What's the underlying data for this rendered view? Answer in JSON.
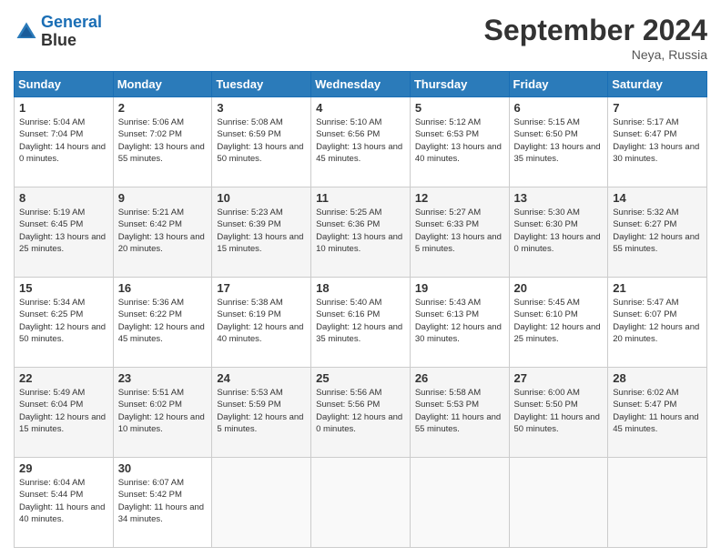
{
  "header": {
    "logo_line1": "General",
    "logo_line2": "Blue",
    "month": "September 2024",
    "location": "Neya, Russia"
  },
  "weekdays": [
    "Sunday",
    "Monday",
    "Tuesday",
    "Wednesday",
    "Thursday",
    "Friday",
    "Saturday"
  ],
  "weeks": [
    [
      {
        "day": "1",
        "sunrise": "5:04 AM",
        "sunset": "7:04 PM",
        "daylight": "14 hours and 0 minutes."
      },
      {
        "day": "2",
        "sunrise": "5:06 AM",
        "sunset": "7:02 PM",
        "daylight": "13 hours and 55 minutes."
      },
      {
        "day": "3",
        "sunrise": "5:08 AM",
        "sunset": "6:59 PM",
        "daylight": "13 hours and 50 minutes."
      },
      {
        "day": "4",
        "sunrise": "5:10 AM",
        "sunset": "6:56 PM",
        "daylight": "13 hours and 45 minutes."
      },
      {
        "day": "5",
        "sunrise": "5:12 AM",
        "sunset": "6:53 PM",
        "daylight": "13 hours and 40 minutes."
      },
      {
        "day": "6",
        "sunrise": "5:15 AM",
        "sunset": "6:50 PM",
        "daylight": "13 hours and 35 minutes."
      },
      {
        "day": "7",
        "sunrise": "5:17 AM",
        "sunset": "6:47 PM",
        "daylight": "13 hours and 30 minutes."
      }
    ],
    [
      {
        "day": "8",
        "sunrise": "5:19 AM",
        "sunset": "6:45 PM",
        "daylight": "13 hours and 25 minutes."
      },
      {
        "day": "9",
        "sunrise": "5:21 AM",
        "sunset": "6:42 PM",
        "daylight": "13 hours and 20 minutes."
      },
      {
        "day": "10",
        "sunrise": "5:23 AM",
        "sunset": "6:39 PM",
        "daylight": "13 hours and 15 minutes."
      },
      {
        "day": "11",
        "sunrise": "5:25 AM",
        "sunset": "6:36 PM",
        "daylight": "13 hours and 10 minutes."
      },
      {
        "day": "12",
        "sunrise": "5:27 AM",
        "sunset": "6:33 PM",
        "daylight": "13 hours and 5 minutes."
      },
      {
        "day": "13",
        "sunrise": "5:30 AM",
        "sunset": "6:30 PM",
        "daylight": "13 hours and 0 minutes."
      },
      {
        "day": "14",
        "sunrise": "5:32 AM",
        "sunset": "6:27 PM",
        "daylight": "12 hours and 55 minutes."
      }
    ],
    [
      {
        "day": "15",
        "sunrise": "5:34 AM",
        "sunset": "6:25 PM",
        "daylight": "12 hours and 50 minutes."
      },
      {
        "day": "16",
        "sunrise": "5:36 AM",
        "sunset": "6:22 PM",
        "daylight": "12 hours and 45 minutes."
      },
      {
        "day": "17",
        "sunrise": "5:38 AM",
        "sunset": "6:19 PM",
        "daylight": "12 hours and 40 minutes."
      },
      {
        "day": "18",
        "sunrise": "5:40 AM",
        "sunset": "6:16 PM",
        "daylight": "12 hours and 35 minutes."
      },
      {
        "day": "19",
        "sunrise": "5:43 AM",
        "sunset": "6:13 PM",
        "daylight": "12 hours and 30 minutes."
      },
      {
        "day": "20",
        "sunrise": "5:45 AM",
        "sunset": "6:10 PM",
        "daylight": "12 hours and 25 minutes."
      },
      {
        "day": "21",
        "sunrise": "5:47 AM",
        "sunset": "6:07 PM",
        "daylight": "12 hours and 20 minutes."
      }
    ],
    [
      {
        "day": "22",
        "sunrise": "5:49 AM",
        "sunset": "6:04 PM",
        "daylight": "12 hours and 15 minutes."
      },
      {
        "day": "23",
        "sunrise": "5:51 AM",
        "sunset": "6:02 PM",
        "daylight": "12 hours and 10 minutes."
      },
      {
        "day": "24",
        "sunrise": "5:53 AM",
        "sunset": "5:59 PM",
        "daylight": "12 hours and 5 minutes."
      },
      {
        "day": "25",
        "sunrise": "5:56 AM",
        "sunset": "5:56 PM",
        "daylight": "12 hours and 0 minutes."
      },
      {
        "day": "26",
        "sunrise": "5:58 AM",
        "sunset": "5:53 PM",
        "daylight": "11 hours and 55 minutes."
      },
      {
        "day": "27",
        "sunrise": "6:00 AM",
        "sunset": "5:50 PM",
        "daylight": "11 hours and 50 minutes."
      },
      {
        "day": "28",
        "sunrise": "6:02 AM",
        "sunset": "5:47 PM",
        "daylight": "11 hours and 45 minutes."
      }
    ],
    [
      {
        "day": "29",
        "sunrise": "6:04 AM",
        "sunset": "5:44 PM",
        "daylight": "11 hours and 40 minutes."
      },
      {
        "day": "30",
        "sunrise": "6:07 AM",
        "sunset": "5:42 PM",
        "daylight": "11 hours and 34 minutes."
      },
      null,
      null,
      null,
      null,
      null
    ]
  ]
}
